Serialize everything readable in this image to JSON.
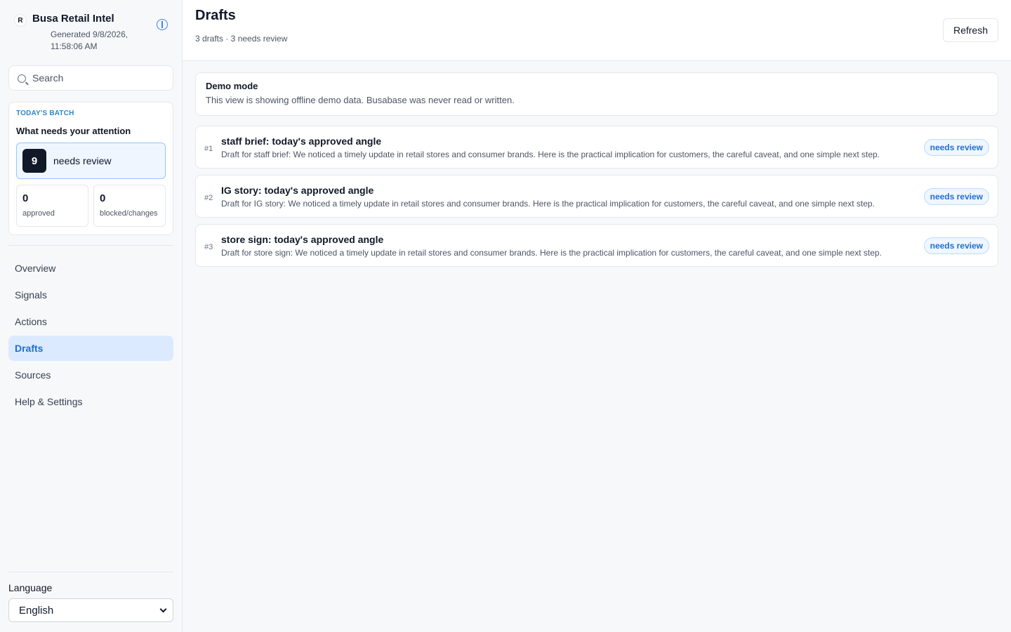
{
  "app": {
    "brand_initial": "R",
    "name": "Busa Retail Intel",
    "generated": "Generated 9/8/2026, 11:58:06 AM"
  },
  "search": {
    "placeholder": "Search"
  },
  "batch": {
    "kicker": "TODAY'S BATCH",
    "title": "What needs your attention",
    "needs_review_count": "9",
    "needs_review_label": "needs review",
    "approved_count": "0",
    "approved_label": "approved",
    "blocked_count": "0",
    "blocked_label": "blocked/changes"
  },
  "nav": {
    "items": [
      {
        "label": "Overview"
      },
      {
        "label": "Signals"
      },
      {
        "label": "Actions"
      },
      {
        "label": "Drafts"
      },
      {
        "label": "Sources"
      },
      {
        "label": "Help & Settings"
      }
    ],
    "active": "Drafts"
  },
  "language": {
    "label": "Language",
    "value": "English"
  },
  "header": {
    "title": "Drafts",
    "subtitle": "3 drafts · 3 needs review",
    "refresh_label": "Refresh"
  },
  "notice": {
    "title": "Demo mode",
    "text": "This view is showing offline demo data. Busabase was never read or written."
  },
  "drafts": [
    {
      "num": "#1",
      "title": "staff brief: today's approved angle",
      "text": "Draft for staff brief: We noticed a timely update in retail stores and consumer brands. Here is the practical implication for customers, the careful caveat, and one simple next step.",
      "status": "needs review"
    },
    {
      "num": "#2",
      "title": "IG story: today's approved angle",
      "text": "Draft for IG story: We noticed a timely update in retail stores and consumer brands. Here is the practical implication for customers, the careful caveat, and one simple next step.",
      "status": "needs review"
    },
    {
      "num": "#3",
      "title": "store sign: today's approved angle",
      "text": "Draft for store sign: We noticed a timely update in retail stores and consumer brands. Here is the practical implication for customers, the careful caveat, and one simple next step.",
      "status": "needs review"
    }
  ],
  "colors": {
    "accent": "#1e6fd0",
    "active_nav_bg": "#dbeafe",
    "kicker": "#2b87c9"
  }
}
